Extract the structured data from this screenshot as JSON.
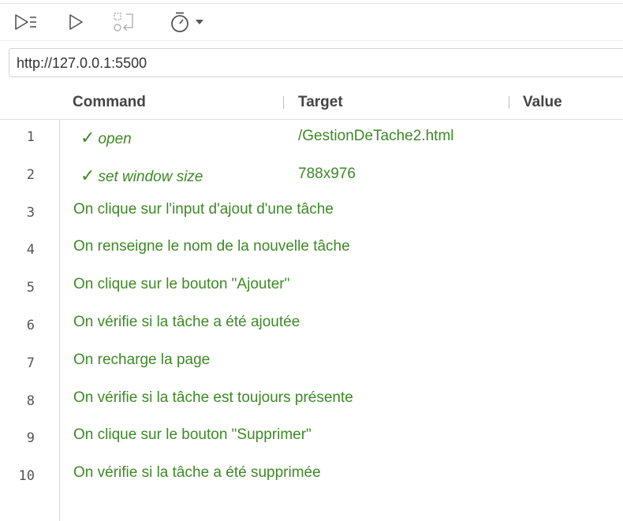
{
  "toolbar": {
    "buttons": [
      {
        "name": "run-all-tests",
        "icon": "run-all-icon"
      },
      {
        "name": "run-current-test",
        "icon": "play-icon"
      },
      {
        "name": "step-over",
        "icon": "step-icon"
      },
      {
        "name": "test-speed",
        "icon": "stopwatch-icon"
      }
    ]
  },
  "url_bar": {
    "value": "http://127.0.0.1:5500"
  },
  "table": {
    "headers": {
      "command": "Command",
      "target": "Target",
      "value": "Value"
    },
    "rows": [
      {
        "num": "1",
        "type": "command",
        "command": "open",
        "target": "/GestionDeTache2.html",
        "value": ""
      },
      {
        "num": "2",
        "type": "command",
        "command": "set window size",
        "target": "788x976",
        "value": ""
      },
      {
        "num": "3",
        "type": "comment",
        "text": "On clique sur l'input d'ajout d'une tâche"
      },
      {
        "num": "4",
        "type": "comment",
        "text": "On renseigne le nom de la nouvelle tâche"
      },
      {
        "num": "5",
        "type": "comment",
        "text": "On clique sur le bouton \"Ajouter\""
      },
      {
        "num": "6",
        "type": "comment",
        "text": "On vérifie si la tâche a été ajoutée"
      },
      {
        "num": "7",
        "type": "comment",
        "text": "On recharge la page"
      },
      {
        "num": "8",
        "type": "comment",
        "text": "On vérifie si la tâche est toujours présente"
      },
      {
        "num": "9",
        "type": "comment",
        "text": "On clique sur le bouton \"Supprimer\""
      },
      {
        "num": "10",
        "type": "comment",
        "text": "On vérifie si la tâche a été supprimée"
      }
    ],
    "check_glyph": "✓"
  },
  "colors": {
    "command_green": "#3c8a25",
    "header_text": "#444444",
    "line_number": "#555555"
  }
}
